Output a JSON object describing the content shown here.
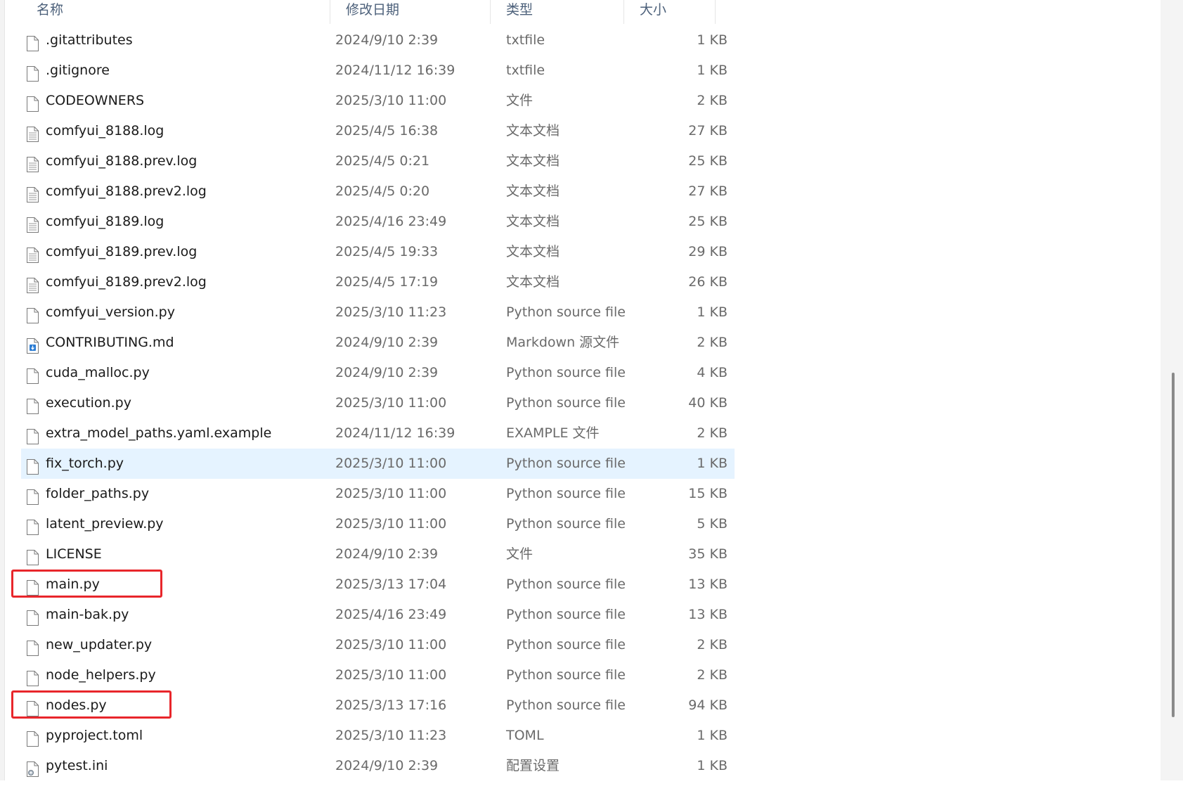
{
  "columns": {
    "name": "名称",
    "date": "修改日期",
    "type": "类型",
    "size": "大小"
  },
  "files": [
    {
      "name": ".gitattributes",
      "date": "2024/9/10 2:39",
      "type": "txtfile",
      "size": "1 KB",
      "icon": "blank-file-icon"
    },
    {
      "name": ".gitignore",
      "date": "2024/11/12 16:39",
      "type": "txtfile",
      "size": "1 KB",
      "icon": "blank-file-icon"
    },
    {
      "name": "CODEOWNERS",
      "date": "2025/3/10 11:00",
      "type": "文件",
      "size": "2 KB",
      "icon": "blank-file-icon"
    },
    {
      "name": "comfyui_8188.log",
      "date": "2025/4/5 16:38",
      "type": "文本文档",
      "size": "27 KB",
      "icon": "text-file-icon"
    },
    {
      "name": "comfyui_8188.prev.log",
      "date": "2025/4/5 0:21",
      "type": "文本文档",
      "size": "25 KB",
      "icon": "text-file-icon"
    },
    {
      "name": "comfyui_8188.prev2.log",
      "date": "2025/4/5 0:20",
      "type": "文本文档",
      "size": "27 KB",
      "icon": "text-file-icon"
    },
    {
      "name": "comfyui_8189.log",
      "date": "2025/4/16 23:49",
      "type": "文本文档",
      "size": "25 KB",
      "icon": "text-file-icon"
    },
    {
      "name": "comfyui_8189.prev.log",
      "date": "2025/4/5 19:33",
      "type": "文本文档",
      "size": "29 KB",
      "icon": "text-file-icon"
    },
    {
      "name": "comfyui_8189.prev2.log",
      "date": "2025/4/5 17:19",
      "type": "文本文档",
      "size": "26 KB",
      "icon": "text-file-icon"
    },
    {
      "name": "comfyui_version.py",
      "date": "2025/3/10 11:23",
      "type": "Python source file",
      "size": "1 KB",
      "icon": "blank-file-icon"
    },
    {
      "name": "CONTRIBUTING.md",
      "date": "2024/9/10 2:39",
      "type": "Markdown 源文件",
      "size": "2 KB",
      "icon": "markdown-file-icon"
    },
    {
      "name": "cuda_malloc.py",
      "date": "2024/9/10 2:39",
      "type": "Python source file",
      "size": "4 KB",
      "icon": "blank-file-icon"
    },
    {
      "name": "execution.py",
      "date": "2025/3/10 11:00",
      "type": "Python source file",
      "size": "40 KB",
      "icon": "blank-file-icon"
    },
    {
      "name": "extra_model_paths.yaml.example",
      "date": "2024/11/12 16:39",
      "type": "EXAMPLE 文件",
      "size": "2 KB",
      "icon": "blank-file-icon"
    },
    {
      "name": "fix_torch.py",
      "date": "2025/3/10 11:00",
      "type": "Python source file",
      "size": "1 KB",
      "icon": "blank-file-icon",
      "selected": true
    },
    {
      "name": "folder_paths.py",
      "date": "2025/3/10 11:00",
      "type": "Python source file",
      "size": "15 KB",
      "icon": "blank-file-icon"
    },
    {
      "name": "latent_preview.py",
      "date": "2025/3/10 11:00",
      "type": "Python source file",
      "size": "5 KB",
      "icon": "blank-file-icon"
    },
    {
      "name": "LICENSE",
      "date": "2024/9/10 2:39",
      "type": "文件",
      "size": "35 KB",
      "icon": "blank-file-icon"
    },
    {
      "name": "main.py",
      "date": "2025/3/13 17:04",
      "type": "Python source file",
      "size": "13 KB",
      "icon": "blank-file-icon",
      "highlighted": true
    },
    {
      "name": "main-bak.py",
      "date": "2025/4/16 23:49",
      "type": "Python source file",
      "size": "13 KB",
      "icon": "blank-file-icon"
    },
    {
      "name": "new_updater.py",
      "date": "2025/3/10 11:00",
      "type": "Python source file",
      "size": "2 KB",
      "icon": "blank-file-icon"
    },
    {
      "name": "node_helpers.py",
      "date": "2025/3/10 11:00",
      "type": "Python source file",
      "size": "2 KB",
      "icon": "blank-file-icon"
    },
    {
      "name": "nodes.py",
      "date": "2025/3/13 17:16",
      "type": "Python source file",
      "size": "94 KB",
      "icon": "blank-file-icon",
      "highlighted": true
    },
    {
      "name": "pyproject.toml",
      "date": "2025/3/10 11:23",
      "type": "TOML",
      "size": "1 KB",
      "icon": "blank-file-icon"
    },
    {
      "name": "pytest.ini",
      "date": "2024/9/10 2:39",
      "type": "配置设置",
      "size": "1 KB",
      "icon": "settings-file-icon"
    }
  ],
  "colors": {
    "selection": "#e5f3ff",
    "highlight_border": "#e8262b",
    "header_text": "#4c607a"
  }
}
